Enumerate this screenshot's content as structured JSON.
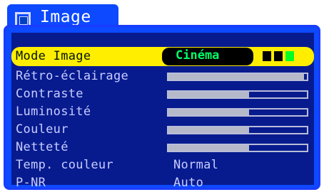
{
  "header": {
    "title": "Image"
  },
  "menu": {
    "mode": {
      "label": "Mode Image",
      "value": "Cinéma",
      "indicators": [
        "#000000",
        "#000000",
        "#00ff22"
      ]
    },
    "backlight": {
      "label": "Rétro-éclairage",
      "level": 0.98
    },
    "contrast": {
      "label": "Contraste",
      "level": 0.58
    },
    "brightness": {
      "label": "Luminosité",
      "level": 0.58
    },
    "color": {
      "label": "Couleur",
      "level": 0.58
    },
    "sharpness": {
      "label": "Netteté",
      "level": 0.58
    },
    "temperature": {
      "label": "Temp. couleur",
      "value": "Normal"
    },
    "pnr": {
      "label": "P-NR",
      "value": "Auto"
    }
  },
  "colors": {
    "accent": "#0c49ff",
    "highlight": "#ffee00",
    "background": "#071b8f"
  }
}
